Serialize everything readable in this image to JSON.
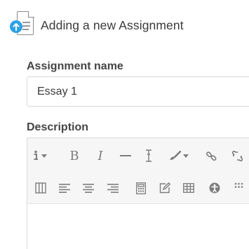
{
  "header": {
    "title": "Adding a new Assignment",
    "icon": "assignment-icon"
  },
  "form": {
    "assignment_name_label": "Assignment name",
    "assignment_name_value": "Essay 1",
    "description_label": "Description"
  },
  "editor_toolbar": {
    "row1": [
      "info-icon",
      "dropdown-caret-icon",
      "bold-icon",
      "italic-icon",
      "horizontal-rule-icon",
      "cursor-icon",
      "paint-brush-icon",
      "dropdown-caret-icon",
      "link-icon",
      "unlink-icon"
    ],
    "row2": [
      "columns-icon",
      "align-left-icon",
      "align-center-icon",
      "align-right-icon",
      "calculator-icon",
      "edit-icon",
      "table-icon",
      "accessibility-icon",
      "grid-icon"
    ],
    "bold_glyph": "B",
    "italic_glyph": "I"
  },
  "colors": {
    "badge": "#2ea1e6",
    "toolbar_bg": "#f6f6f6",
    "border": "#d9d9d9",
    "icon": "#7d7d7d"
  }
}
